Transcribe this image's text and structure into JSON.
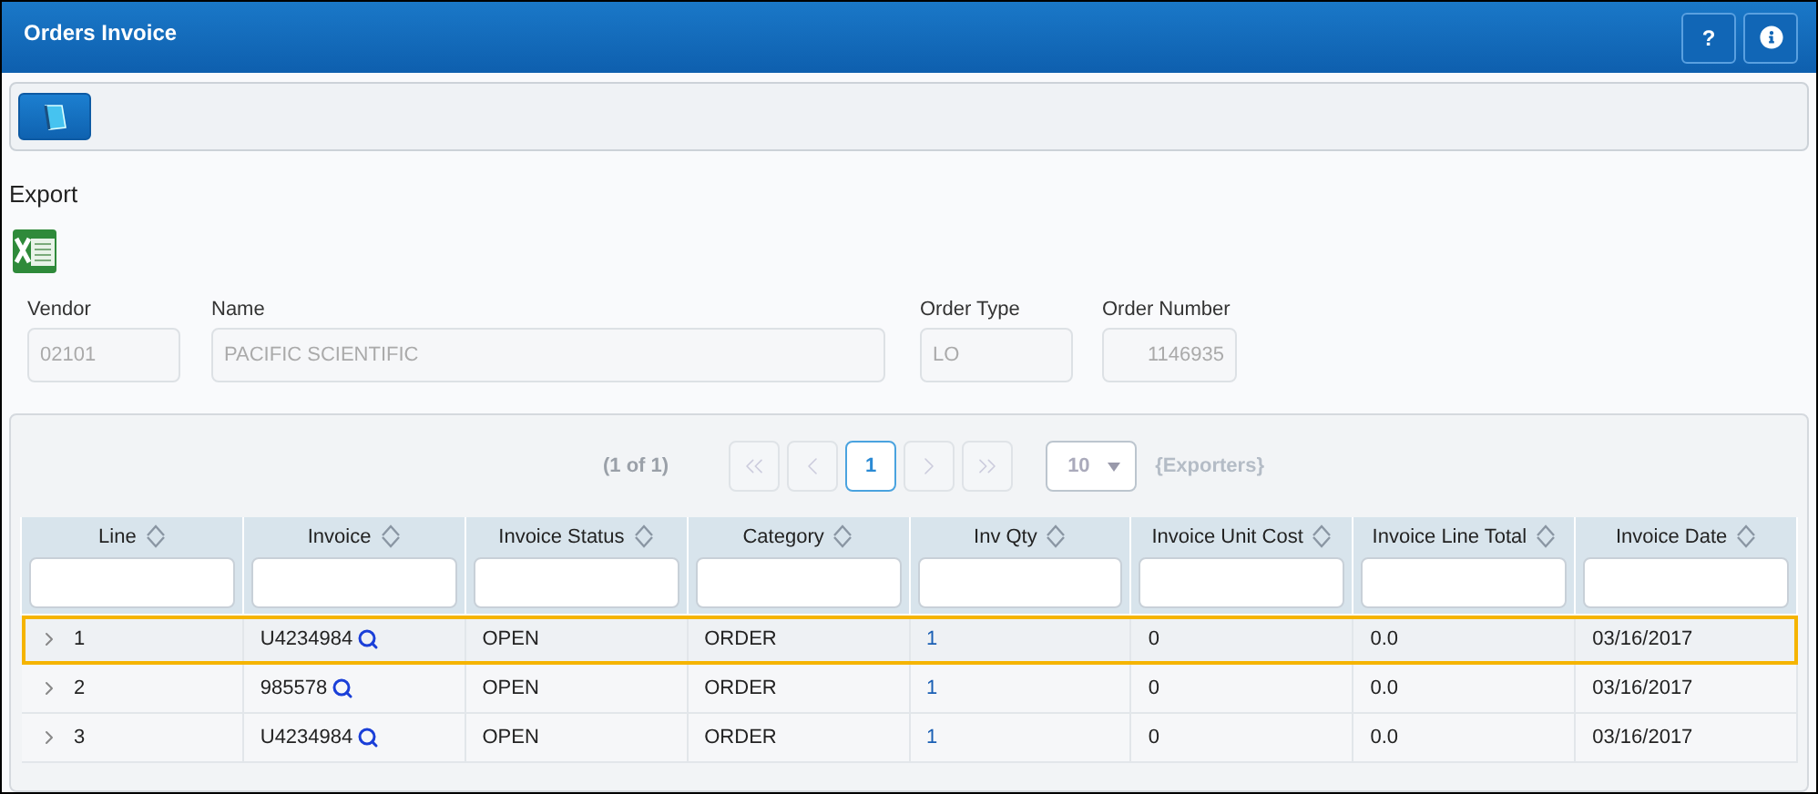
{
  "window": {
    "title": "Orders Invoice",
    "buttons": [
      {
        "kind": "help",
        "label": "?"
      },
      {
        "kind": "info"
      }
    ]
  },
  "toolbar": {
    "buttons": [
      {
        "kind": "notebook"
      }
    ]
  },
  "export": {
    "label": "Export",
    "buttons": [
      {
        "kind": "excel"
      }
    ]
  },
  "fields": [
    {
      "label": "Vendor",
      "value": "02101",
      "kind": "text"
    },
    {
      "label": "Name",
      "value": "PACIFIC SCIENTIFIC",
      "kind": "text"
    },
    {
      "label": "Order Type",
      "value": "LO",
      "kind": "text"
    },
    {
      "label": "Order Number",
      "value": "1146935",
      "kind": "number"
    }
  ],
  "paginator": {
    "summary": "(1 of 1)",
    "pages": [
      {
        "kind": "first",
        "disabled": true
      },
      {
        "kind": "prev",
        "disabled": true
      },
      {
        "kind": "page",
        "label": "1",
        "selected": true
      },
      {
        "kind": "next",
        "disabled": true
      },
      {
        "kind": "last",
        "disabled": true
      }
    ],
    "rows_per_page": "10",
    "exporters": "{Exporters}"
  },
  "table": {
    "columns": [
      "Line",
      "Invoice",
      "Invoice Status",
      "Category",
      "Inv Qty",
      "Invoice Unit Cost",
      "Invoice Line Total",
      "Invoice Date"
    ],
    "rows": [
      {
        "selected": true,
        "cells": [
          "1",
          "U4234984",
          "OPEN",
          "ORDER",
          "1",
          "0",
          "0.0",
          "03/16/2017"
        ]
      },
      {
        "selected": false,
        "cells": [
          "2",
          "985578",
          "OPEN",
          "ORDER",
          "1",
          "0",
          "0.0",
          "03/16/2017"
        ]
      },
      {
        "selected": false,
        "cells": [
          "3",
          "U4234984",
          "OPEN",
          "ORDER",
          "1",
          "0",
          "0.0",
          "03/16/2017"
        ]
      }
    ]
  }
}
